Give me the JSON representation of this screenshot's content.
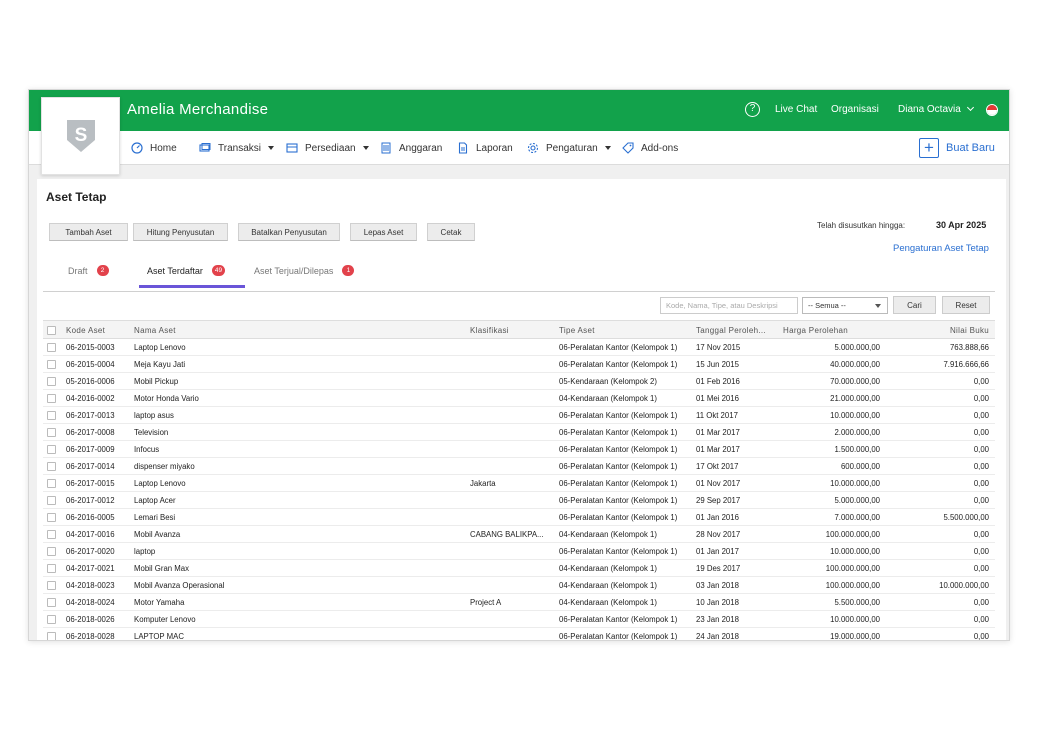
{
  "app": {
    "title": "Amelia Merchandise",
    "logo_letter": "S"
  },
  "topbar": {
    "help": "?",
    "live_chat": "Live Chat",
    "organisasi": "Organisasi",
    "user": "Diana Octavia"
  },
  "nav": {
    "home": "Home",
    "transaksi": "Transaksi",
    "persediaan": "Persediaan",
    "anggaran": "Anggaran",
    "laporan": "Laporan",
    "pengaturan": "Pengaturan",
    "addons": "Add-ons",
    "buat_baru": "Buat Baru"
  },
  "page": {
    "title": "Aset Tetap",
    "buttons": {
      "tambah": "Tambah Aset",
      "hitung": "Hitung Penyusutan",
      "batalkan": "Batalkan Penyusutan",
      "lepas": "Lepas Aset",
      "cetak": "Cetak"
    },
    "depr_label": "Telah disusutkan hingga:",
    "depr_date": "30 Apr 2025",
    "setting_link": "Pengaturan Aset Tetap"
  },
  "tabs": [
    {
      "label": "Draft",
      "count": "2"
    },
    {
      "label": "Aset Terdaftar",
      "count": "49"
    },
    {
      "label": "Aset Terjual/Dilepas",
      "count": "1"
    }
  ],
  "filter": {
    "placeholder": "Kode, Nama, Tipe, atau Deskripsi",
    "select": "-- Semua --",
    "cari": "Cari",
    "reset": "Reset"
  },
  "table": {
    "headers": {
      "kode": "Kode Aset",
      "nama": "Nama Aset",
      "klasifikasi": "Klasifikasi",
      "tipe": "Tipe Aset",
      "tanggal": "Tanggal Peroleh...",
      "harga": "Harga Perolehan",
      "nilai": "Nilai Buku"
    },
    "rows": [
      [
        "06-2015-0003",
        "Laptop Lenovo",
        "",
        "06-Peralatan Kantor (Kelompok 1)",
        "17 Nov 2015",
        "5.000.000,00",
        "763.888,66"
      ],
      [
        "06-2015-0004",
        "Meja Kayu Jati",
        "",
        "06-Peralatan Kantor (Kelompok 1)",
        "15 Jun 2015",
        "40.000.000,00",
        "7.916.666,66"
      ],
      [
        "05-2016-0006",
        "Mobil Pickup",
        "",
        "05-Kendaraan (Kelompok 2)",
        "01 Feb 2016",
        "70.000.000,00",
        "0,00"
      ],
      [
        "04-2016-0002",
        "Motor Honda Vario",
        "",
        "04-Kendaraan (Kelompok 1)",
        "01 Mei 2016",
        "21.000.000,00",
        "0,00"
      ],
      [
        "06-2017-0013",
        "laptop asus",
        "",
        "06-Peralatan Kantor (Kelompok 1)",
        "11 Okt 2017",
        "10.000.000,00",
        "0,00"
      ],
      [
        "06-2017-0008",
        "Television",
        "",
        "06-Peralatan Kantor (Kelompok 1)",
        "01 Mar 2017",
        "2.000.000,00",
        "0,00"
      ],
      [
        "06-2017-0009",
        "Infocus",
        "",
        "06-Peralatan Kantor (Kelompok 1)",
        "01 Mar 2017",
        "1.500.000,00",
        "0,00"
      ],
      [
        "06-2017-0014",
        "dispenser miyako",
        "",
        "06-Peralatan Kantor (Kelompok 1)",
        "17 Okt 2017",
        "600.000,00",
        "0,00"
      ],
      [
        "06-2017-0015",
        "Laptop Lenovo",
        "Jakarta",
        "06-Peralatan Kantor (Kelompok 1)",
        "01 Nov 2017",
        "10.000.000,00",
        "0,00"
      ],
      [
        "06-2017-0012",
        "Laptop Acer",
        "",
        "06-Peralatan Kantor (Kelompok 1)",
        "29 Sep 2017",
        "5.000.000,00",
        "0,00"
      ],
      [
        "06-2016-0005",
        "Lemari Besi",
        "",
        "06-Peralatan Kantor (Kelompok 1)",
        "01 Jan 2016",
        "7.000.000,00",
        "5.500.000,00"
      ],
      [
        "04-2017-0016",
        "Mobil Avanza",
        "CABANG BALIKPA...",
        "04-Kendaraan (Kelompok 1)",
        "28 Nov 2017",
        "100.000.000,00",
        "0,00"
      ],
      [
        "06-2017-0020",
        "laptop",
        "",
        "06-Peralatan Kantor (Kelompok 1)",
        "01 Jan 2017",
        "10.000.000,00",
        "0,00"
      ],
      [
        "04-2017-0021",
        "Mobil Gran Max",
        "",
        "04-Kendaraan (Kelompok 1)",
        "19 Des 2017",
        "100.000.000,00",
        "0,00"
      ],
      [
        "04-2018-0023",
        "Mobil Avanza Operasional",
        "",
        "04-Kendaraan (Kelompok 1)",
        "03 Jan 2018",
        "100.000.000,00",
        "10.000.000,00"
      ],
      [
        "04-2018-0024",
        "Motor Yamaha",
        "Project A",
        "04-Kendaraan (Kelompok 1)",
        "10 Jan 2018",
        "5.500.000,00",
        "0,00"
      ],
      [
        "06-2018-0026",
        "Komputer Lenovo",
        "",
        "06-Peralatan Kantor (Kelompok 1)",
        "23 Jan 2018",
        "10.000.000,00",
        "0,00"
      ],
      [
        "06-2018-0028",
        "LAPTOP MAC",
        "",
        "06-Peralatan Kantor (Kelompok 1)",
        "24 Jan 2018",
        "19.000.000,00",
        "0,00"
      ]
    ]
  }
}
